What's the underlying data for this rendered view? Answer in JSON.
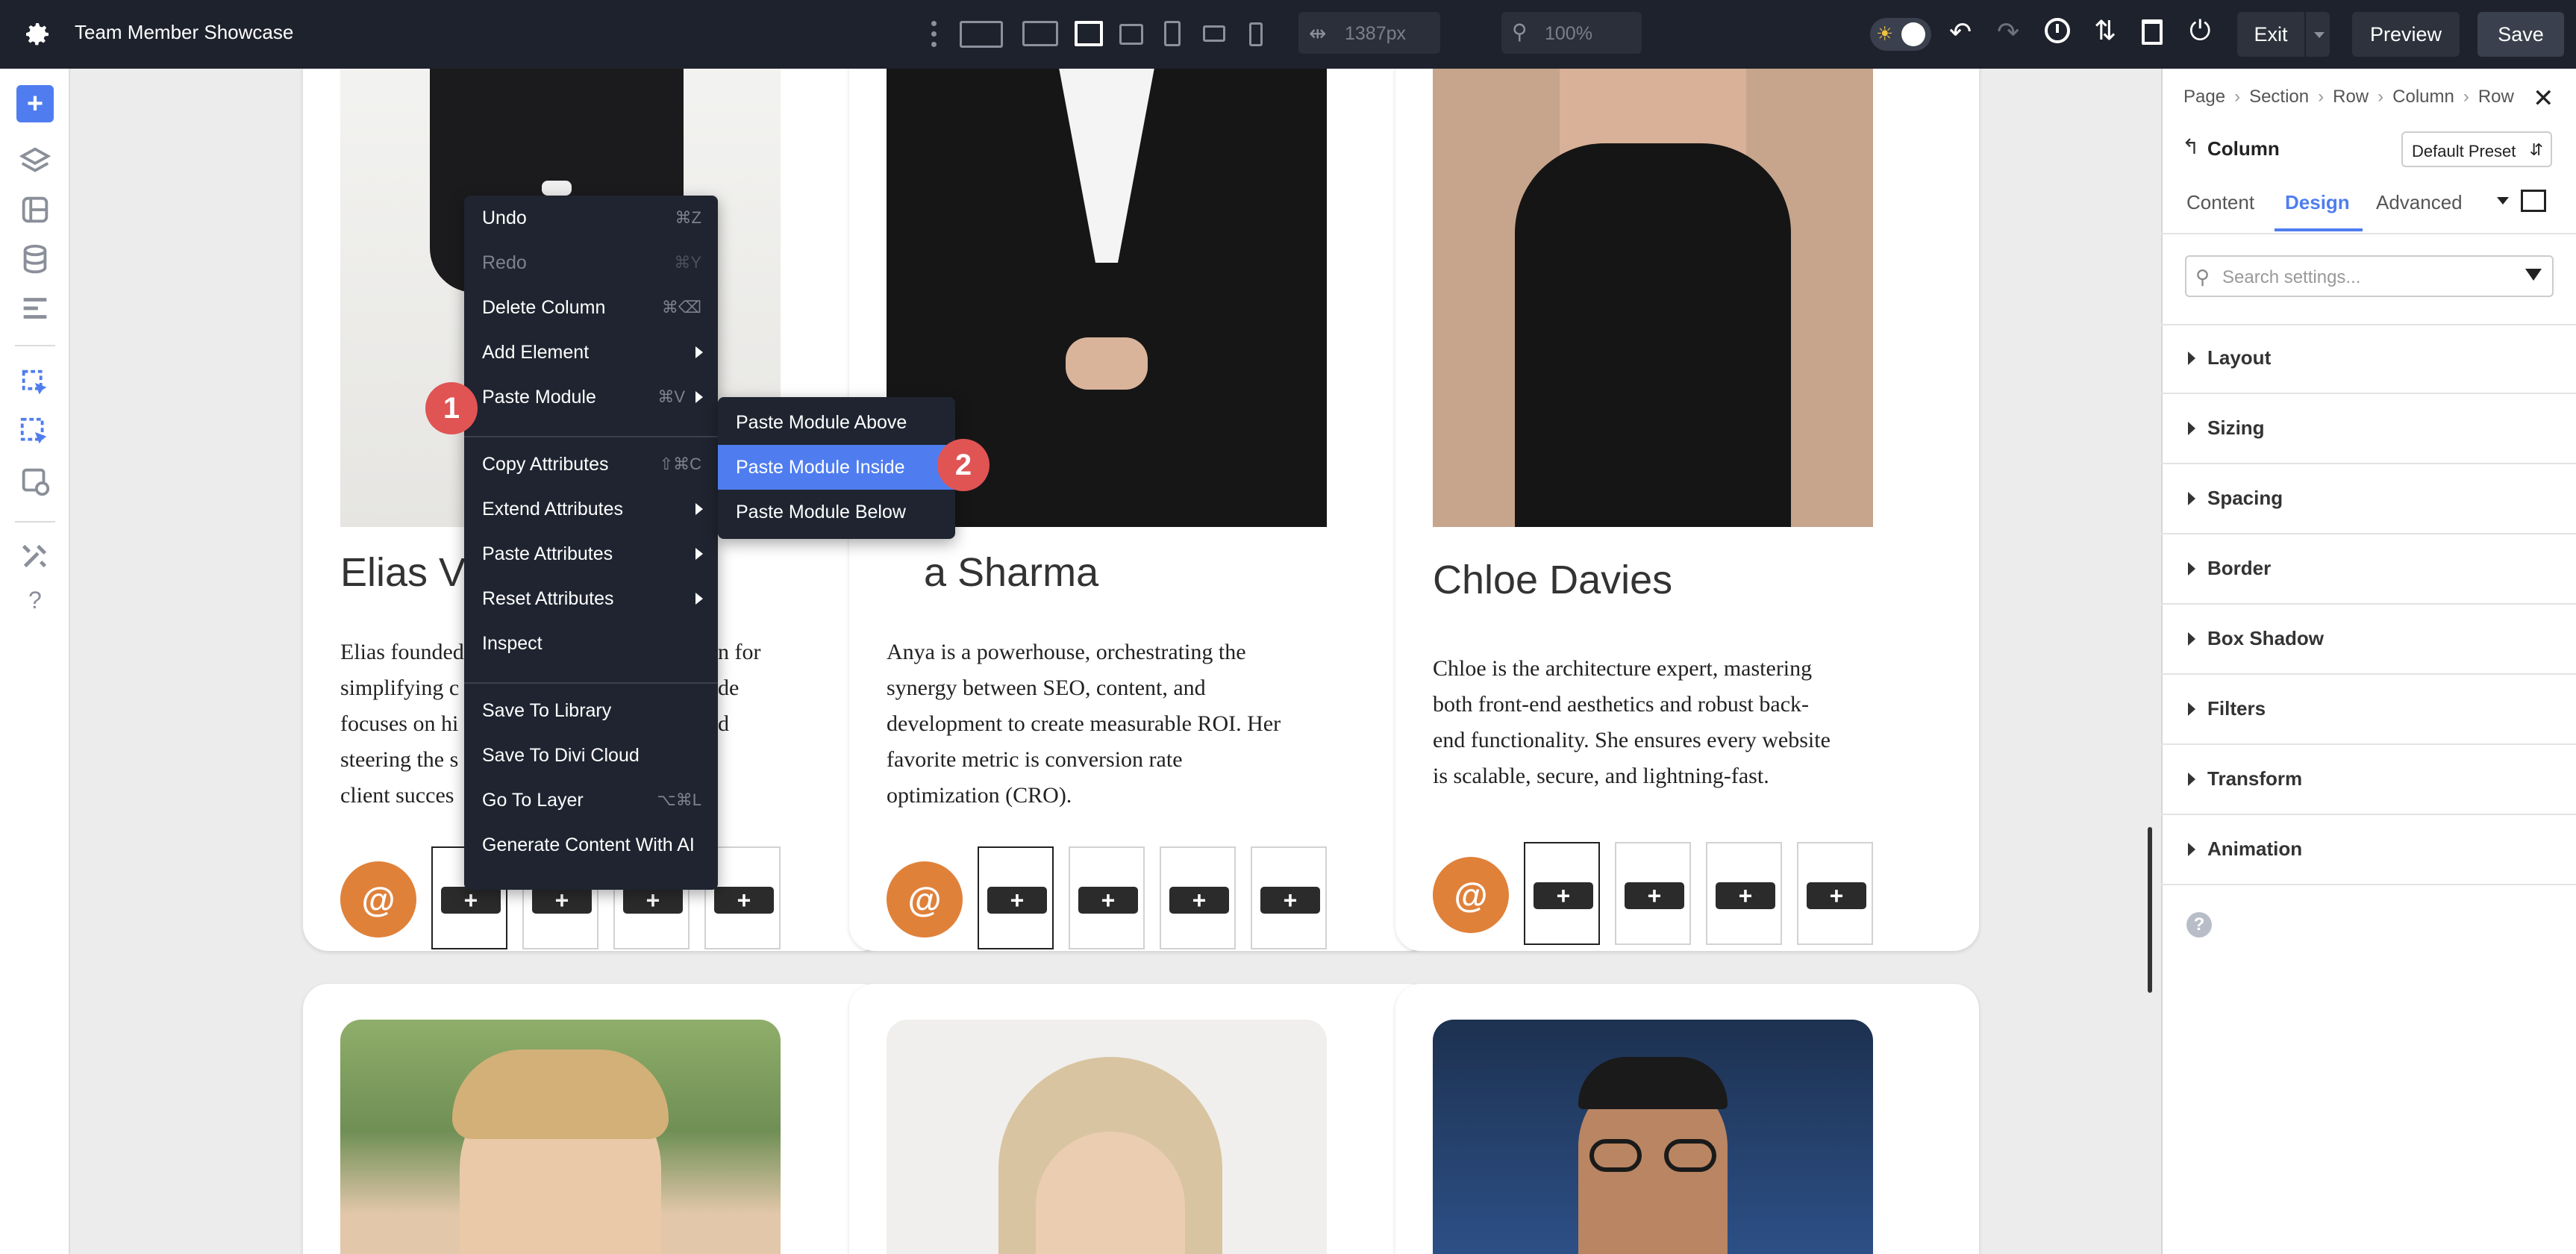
{
  "topbar": {
    "title": "Team Member Showcase",
    "width_value": "1387px",
    "zoom_value": "100%",
    "exit_label": "Exit",
    "preview_label": "Preview",
    "save_label": "Save"
  },
  "team": [
    {
      "name": "Elias Va",
      "bio": [
        "Elias founded",
        "simplifying c",
        "focuses on hi",
        "steering the s",
        "client succes"
      ],
      "bio_tail": [
        "n for",
        "de",
        "",
        "d",
        ""
      ]
    },
    {
      "name": "a Sharma",
      "bio": [
        "Anya is a powerhouse, orchestrating the",
        "synergy between SEO, content, and",
        "development to create measurable ROI. Her",
        "favorite metric is conversion rate",
        "optimization (CRO)."
      ]
    },
    {
      "name": "Chloe Davies",
      "bio": [
        "Chloe is the architecture expert, mastering",
        "both front-end aesthetics and robust back-",
        "end functionality. She ensures every website",
        "is scalable, secure, and lightning-fast."
      ]
    }
  ],
  "social": {
    "at_glyph": "@",
    "plus_glyph": "+"
  },
  "context_menu": {
    "items": [
      {
        "label": "Undo",
        "shortcut": "⌘Z"
      },
      {
        "label": "Redo",
        "shortcut": "⌘Y"
      },
      {
        "label": "Delete Column",
        "shortcut": "⌘⌫"
      },
      {
        "label": "Add Element",
        "shortcut": ""
      },
      {
        "label": "Paste Module",
        "shortcut": "⌘V"
      },
      {
        "label": "Copy Attributes",
        "shortcut": "⇧⌘C"
      },
      {
        "label": "Extend Attributes",
        "shortcut": ""
      },
      {
        "label": "Paste Attributes",
        "shortcut": ""
      },
      {
        "label": "Reset Attributes",
        "shortcut": ""
      },
      {
        "label": "Inspect",
        "shortcut": ""
      },
      {
        "label": "Save To Library",
        "shortcut": ""
      },
      {
        "label": "Save To Divi Cloud",
        "shortcut": ""
      },
      {
        "label": "Go To Layer",
        "shortcut": "⌥⌘L"
      },
      {
        "label": "Generate Content With AI",
        "shortcut": ""
      }
    ]
  },
  "submenu": {
    "items": [
      "Paste Module Above",
      "Paste Module Inside",
      "Paste Module Below"
    ]
  },
  "badges": [
    "1",
    "2"
  ],
  "panel": {
    "breadcrumb": [
      "Page",
      "Section",
      "Row",
      "Column",
      "Row"
    ],
    "breadcrumb_sep": "›",
    "title": "Column",
    "preset": "Default Preset",
    "tabs": [
      "Content",
      "Design",
      "Advanced"
    ],
    "active_tab": "Design",
    "search_placeholder": "Search settings...",
    "sections": [
      "Layout",
      "Sizing",
      "Spacing",
      "Border",
      "Box Shadow",
      "Filters",
      "Transform",
      "Animation"
    ],
    "help_glyph": "?"
  },
  "leftbar": {
    "help_glyph": "?"
  },
  "colors": {
    "accent": "#4f7df0",
    "topbar": "#1e222c",
    "orange": "#e0813a",
    "badge": "#e05454",
    "highlight": "#4f7df0"
  }
}
